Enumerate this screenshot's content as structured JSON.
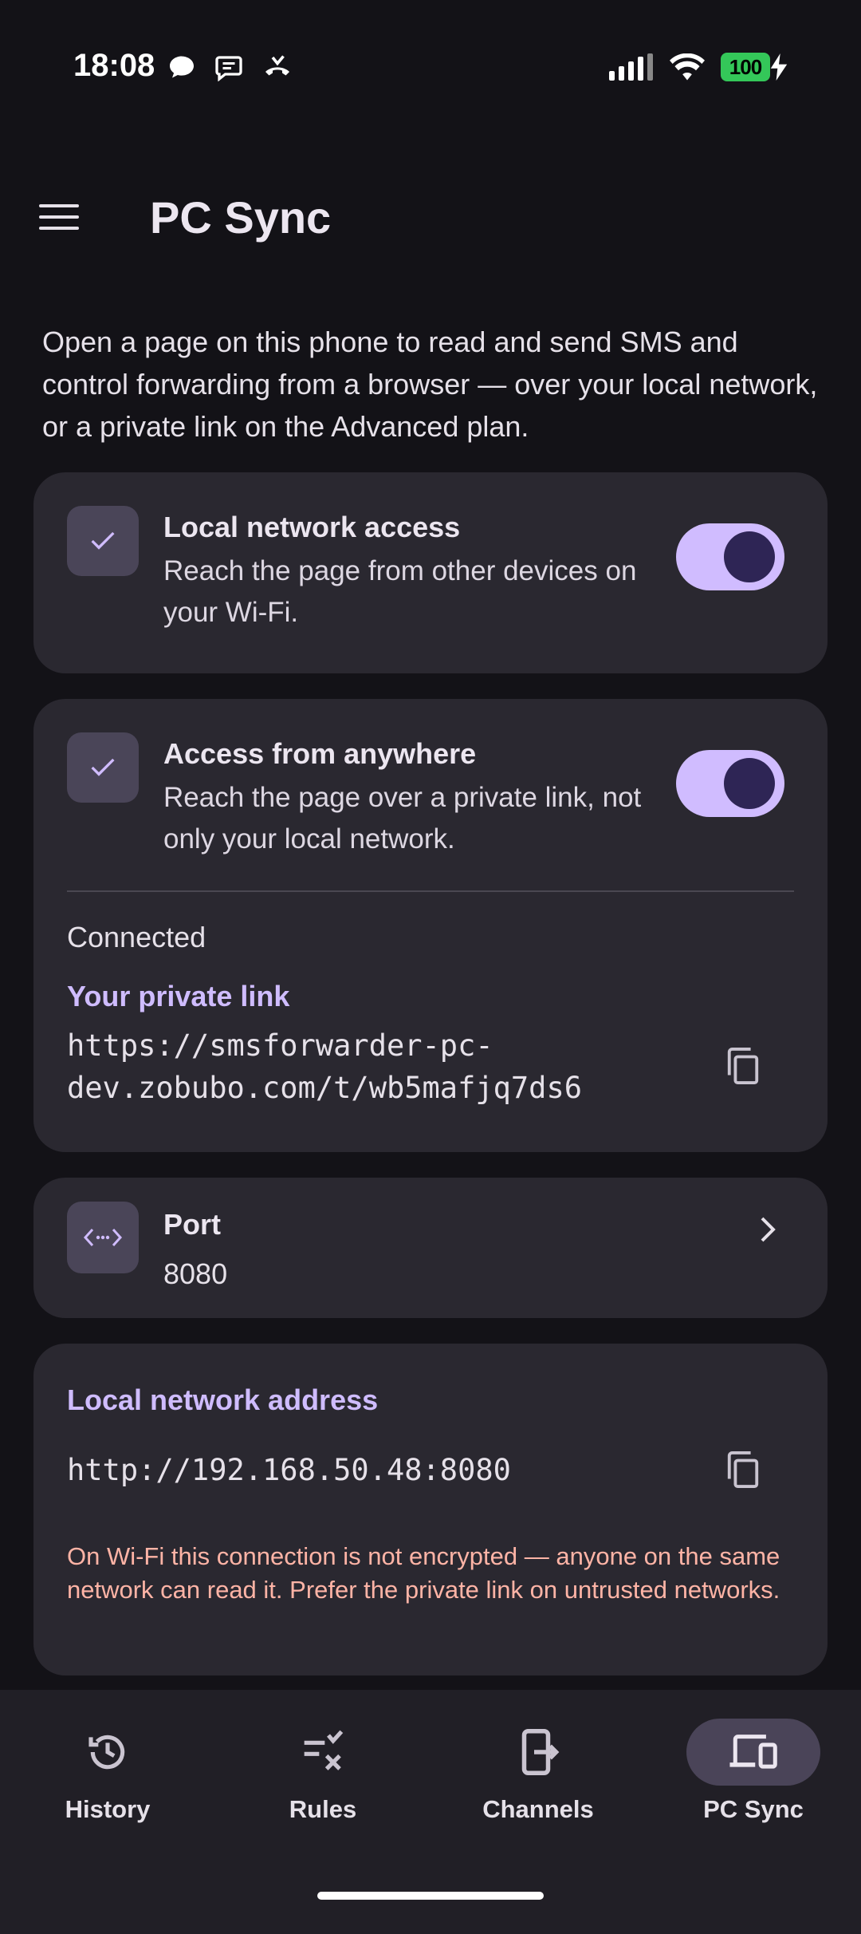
{
  "status_bar": {
    "time": "18:08",
    "battery": "100",
    "icons": [
      "chat-bubble-icon",
      "message-icon",
      "missed-call-icon",
      "signal-icon",
      "wifi-icon",
      "battery-icon",
      "charging-icon"
    ]
  },
  "app_bar": {
    "title": "PC Sync",
    "menu_icon": "menu-icon"
  },
  "intro": "Open a page on this phone to read and send SMS and control forwarding from a browser — over your local network, or a private link on the Advanced plan.",
  "local_access": {
    "title": "Local network access",
    "description": "Reach the page from other devices on your Wi-Fi.",
    "enabled": true
  },
  "anywhere_access": {
    "title": "Access from anywhere",
    "description": "Reach the page over a private link, not only your local network.",
    "enabled": true,
    "status": "Connected",
    "link_label": "Your private link",
    "link_line1": "https://smsforwarder-pc-",
    "link_line2": "dev.zobubo.com/t/wb5mafjq7ds6"
  },
  "port": {
    "label": "Port",
    "value": "8080"
  },
  "local_address": {
    "label": "Local network address",
    "value": "http://192.168.50.48:8080",
    "warning": "On Wi-Fi this connection is not encrypted — anyone on the same network can read it. Prefer the private link on untrusted networks."
  },
  "nav": {
    "items": [
      {
        "label": "History",
        "icon": "history-icon"
      },
      {
        "label": "Rules",
        "icon": "rules-icon"
      },
      {
        "label": "Channels",
        "icon": "channels-icon"
      },
      {
        "label": "PC Sync",
        "icon": "pc-sync-icon"
      }
    ],
    "active": "PC Sync"
  },
  "colors": {
    "background": "#131217",
    "card": "#2a2830",
    "accent": "#d0bcff",
    "warning": "#ffb4a6"
  }
}
